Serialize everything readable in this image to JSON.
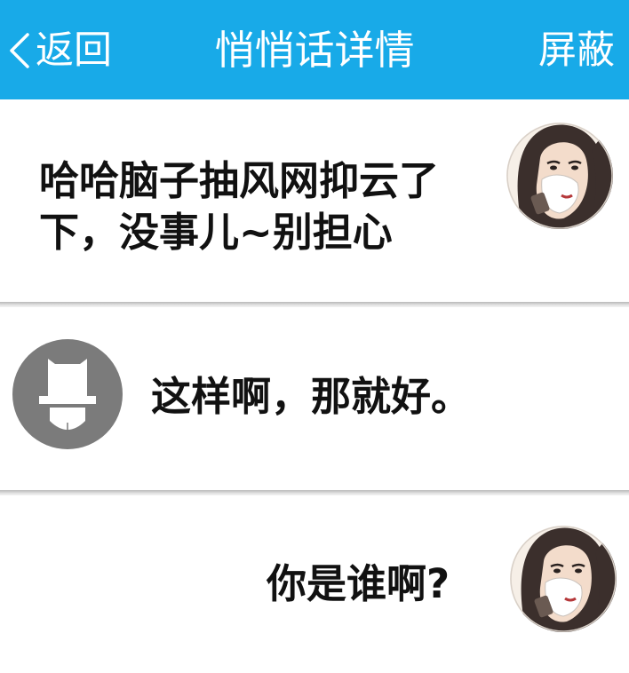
{
  "header": {
    "back_label": "返回",
    "title": "悄悄话详情",
    "block_label": "屏蔽",
    "bg_color": "#18aae8"
  },
  "messages": [
    {
      "text": "哈哈脑子抽风网抑云了下，没事儿~别担心",
      "sender": "woman-avatar"
    },
    {
      "text": "这样啊，那就好。",
      "sender": "anonymous-avatar"
    },
    {
      "text": "你是谁啊?",
      "sender": "woman-avatar"
    }
  ]
}
